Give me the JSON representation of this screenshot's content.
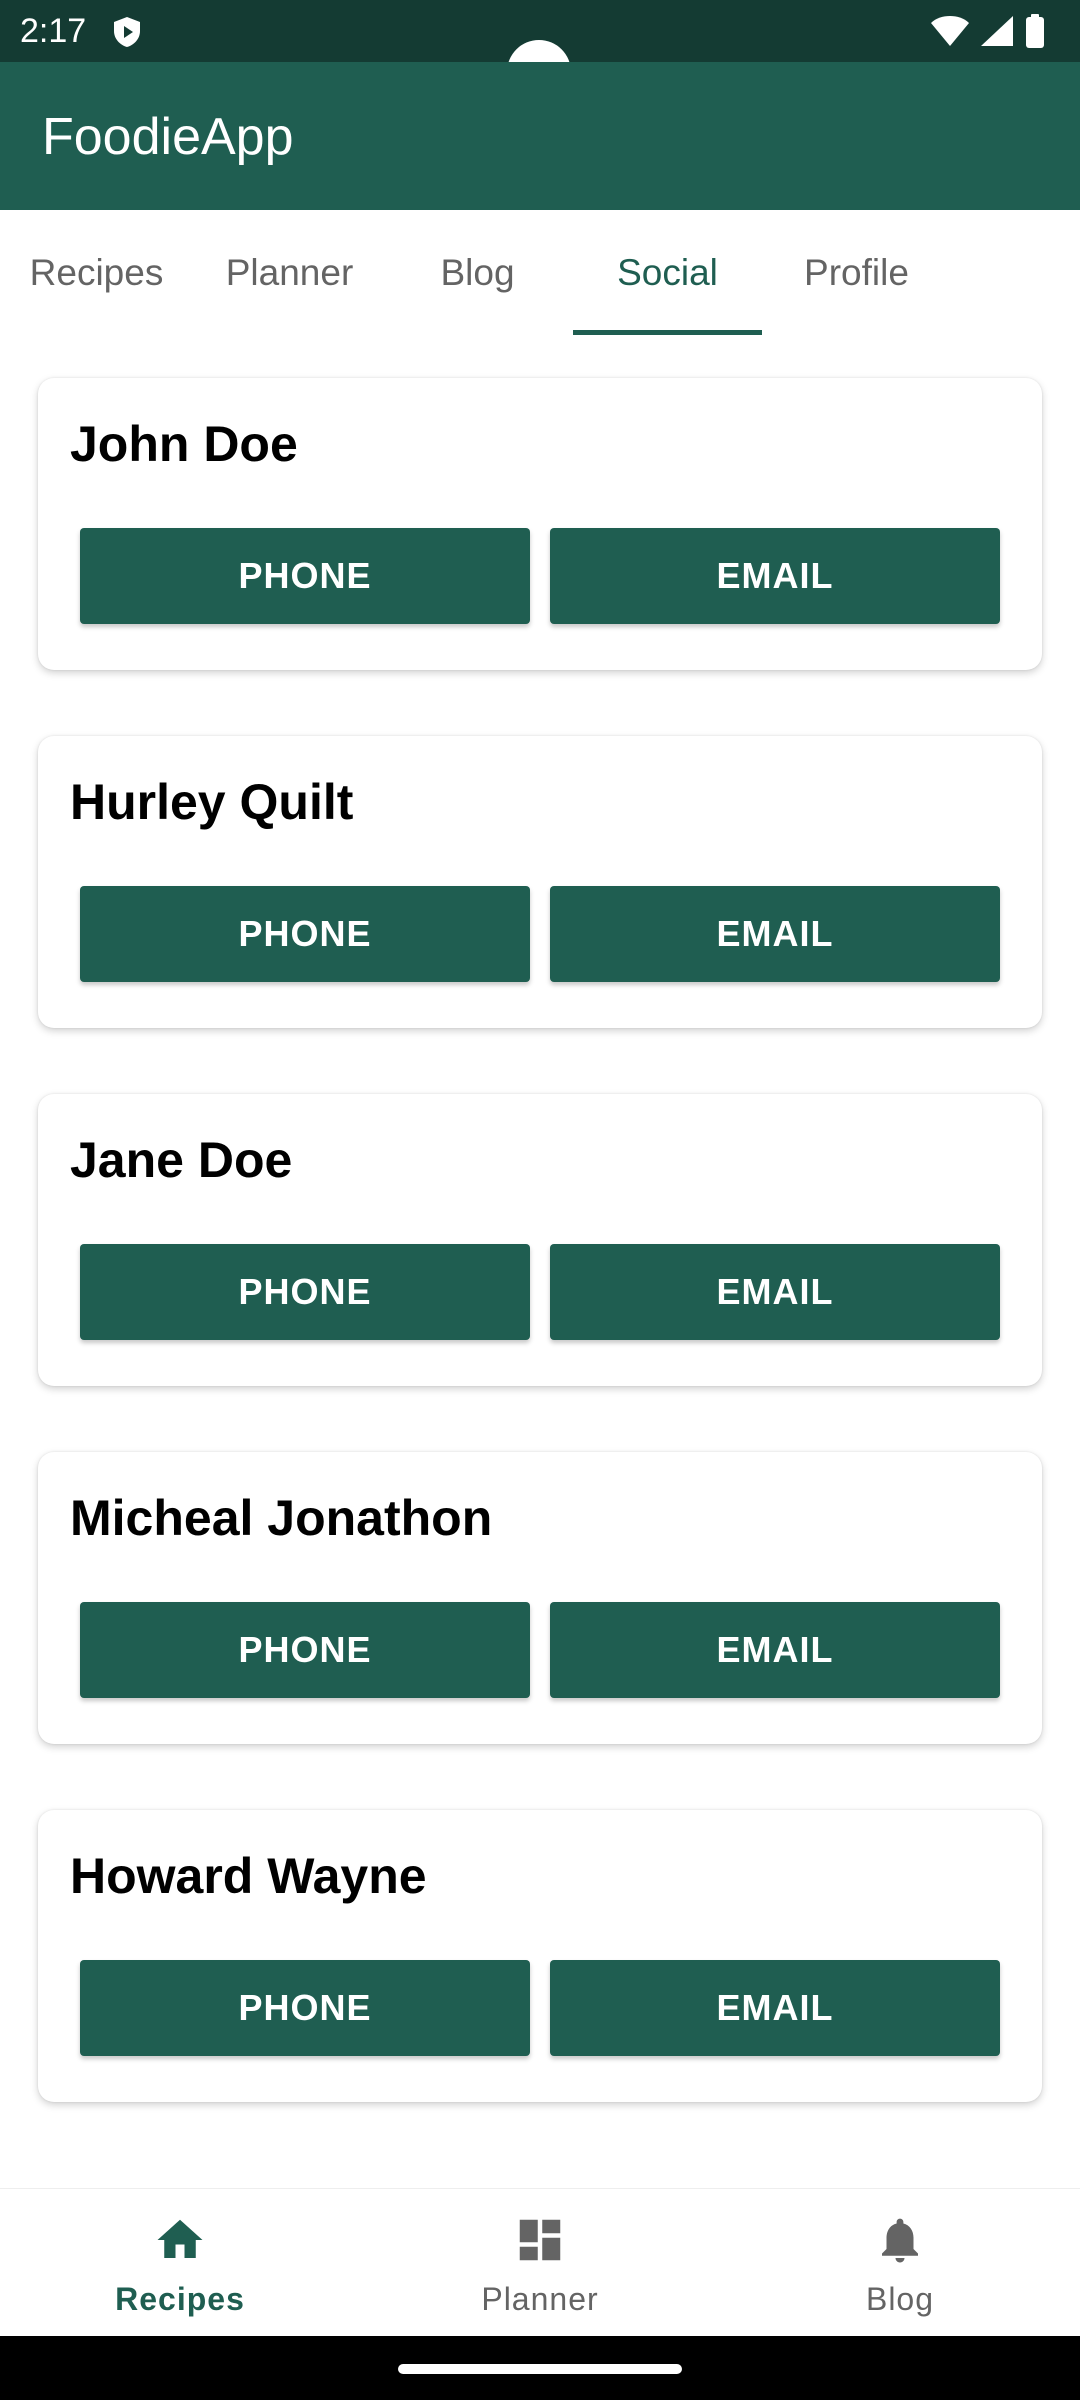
{
  "status_bar": {
    "time": "2:17",
    "icons": [
      "shield-icon",
      "wifi-icon",
      "signal-icon",
      "battery-icon"
    ]
  },
  "app_bar": {
    "title": "FoodieApp"
  },
  "tabs": [
    {
      "label": "Recipes",
      "active": false
    },
    {
      "label": "Planner",
      "active": false
    },
    {
      "label": "Blog",
      "active": false
    },
    {
      "label": "Social",
      "active": true
    },
    {
      "label": "Profile",
      "active": false
    }
  ],
  "contacts": [
    {
      "name": "John Doe",
      "phone_label": "PHONE",
      "email_label": "EMAIL"
    },
    {
      "name": "Hurley Quilt",
      "phone_label": "PHONE",
      "email_label": "EMAIL"
    },
    {
      "name": "Jane Doe",
      "phone_label": "PHONE",
      "email_label": "EMAIL"
    },
    {
      "name": "Micheal Jonathon",
      "phone_label": "PHONE",
      "email_label": "EMAIL"
    },
    {
      "name": "Howard Wayne",
      "phone_label": "PHONE",
      "email_label": "EMAIL"
    }
  ],
  "bottom_nav": [
    {
      "label": "Recipes",
      "icon": "home-icon",
      "active": true
    },
    {
      "label": "Planner",
      "icon": "dashboard-icon",
      "active": false
    },
    {
      "label": "Blog",
      "icon": "bell-icon",
      "active": false
    }
  ],
  "colors": {
    "primary": "#1f5e51",
    "status_bar": "#143b33",
    "inactive_text": "#646464"
  }
}
